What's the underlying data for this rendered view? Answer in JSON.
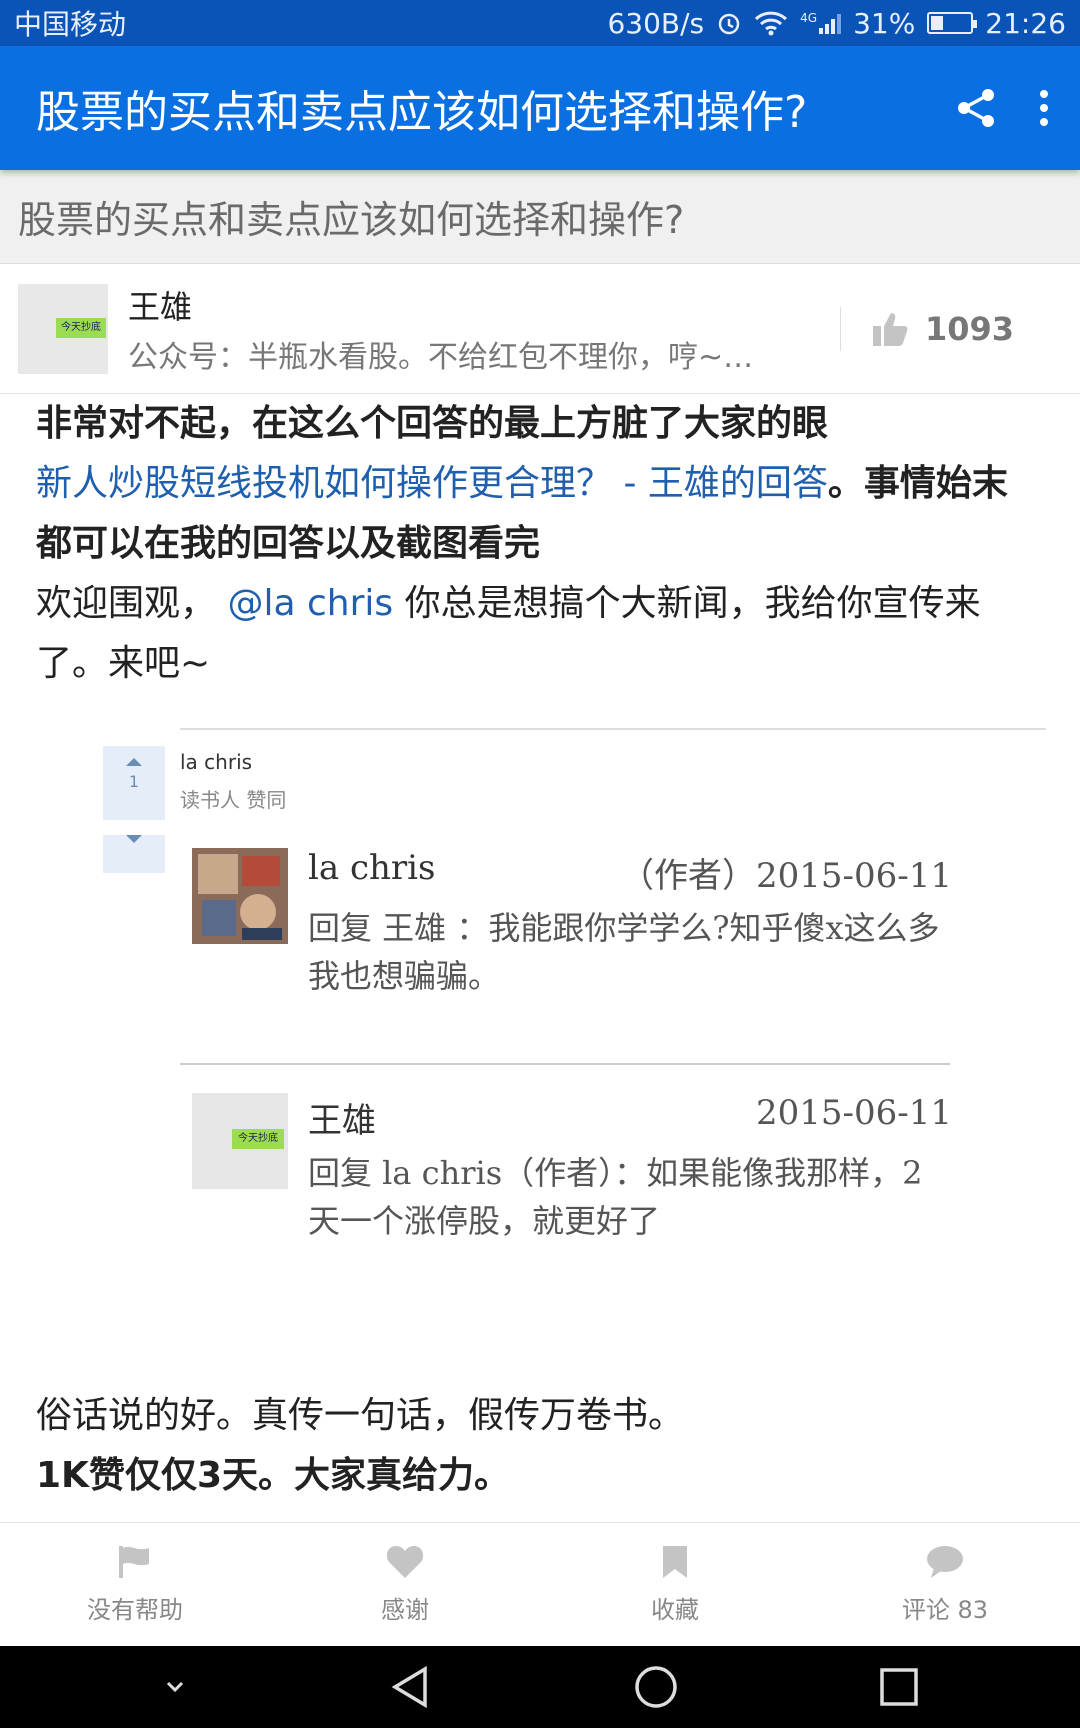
{
  "status_bar": {
    "carrier": "中国移动",
    "net_speed": "630B/s",
    "network": "4G",
    "battery": "31%",
    "battery_level": 0.31,
    "time": "21:26"
  },
  "app_bar": {
    "title": "股票的买点和卖点应该如何选择和操作?"
  },
  "question": {
    "title": "股票的买点和卖点应该如何选择和操作?"
  },
  "author": {
    "name": "王雄",
    "bio": "公众号：半瓶水看股。不给红包不理你，哼~…",
    "avatar_tag": "今天抄底",
    "likes": "1093"
  },
  "content": {
    "p1": "非常对不起，在这么个回答的最上方脏了大家的眼",
    "p2_link": "新人炒股短线投机如何操作更合理？ - 王雄的回答",
    "p2_tail": "。事情始末都可以在我的回答以及截图看完",
    "p3_head": "欢迎围观，",
    "p3_mention": "@la chris",
    "p3_tail": "你总是想搞个大新闻，我给你宣传来了。来吧~",
    "p4": "俗话说的好。真传一句话，假传万卷书。",
    "p5": "1K赞仅仅3天。大家真给力。"
  },
  "screenshot": {
    "vote_count": "1",
    "top_user": "la chris",
    "top_user_line": "读书人 赞同",
    "comments": [
      {
        "name": "la chris",
        "date": "（作者）2015-06-11",
        "text": "回复 王雄 ：我能跟你学学么?知乎傻x这么多我也想骗骗。"
      },
      {
        "name": "王雄",
        "date": "2015-06-11",
        "text": "回复 la chris（作者）：如果能像我那样，2天一个涨停股，就更好了"
      }
    ],
    "avatar_tag": "今天抄底"
  },
  "actions": {
    "unhelpful": "没有帮助",
    "thanks": "感谢",
    "collect": "收藏",
    "comments": "评论 83"
  },
  "colors": {
    "status_bar": "#0a54b8",
    "app_bar": "#0a6fe0",
    "link": "#1f5fad"
  }
}
